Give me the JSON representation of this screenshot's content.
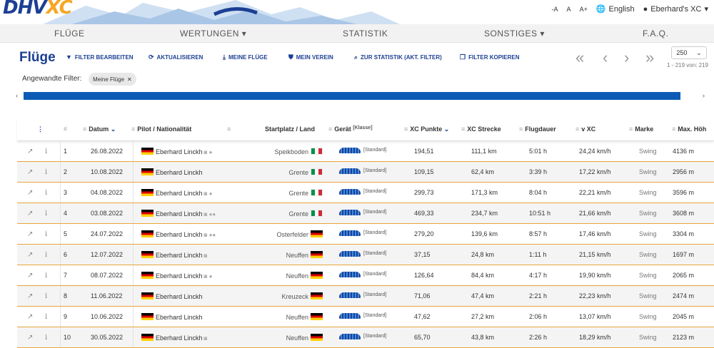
{
  "header": {
    "logo_main": "DHV",
    "logo_xc": "XC",
    "font_small": "-A",
    "font_normal": "A",
    "font_large": "A+",
    "language": "English",
    "user": "Eberhard's XC"
  },
  "nav": {
    "items": [
      "FLÜGE",
      "WERTUNGEN ▾",
      "STATISTIK",
      "SONSTIGES ▾",
      "F.A.Q."
    ]
  },
  "toolbar": {
    "title": "Flüge",
    "buttons": [
      "FILTER BEARBEITEN",
      "AKTUALISIEREN",
      "MEINE FLÜGE",
      "MEIN VEREIN",
      "ZUR STATISTIK (AKT. FILTER)",
      "FILTER KOPIEREN"
    ],
    "pager": [
      "«",
      "‹",
      "›",
      "»"
    ],
    "per_page": "250",
    "range": "1 - 219 von: 219"
  },
  "filter": {
    "label": "Angewandte Filter:",
    "chip": "Meine Flüge"
  },
  "table": {
    "headers": {
      "num": "#",
      "date": "Datum",
      "pilot": "Pilot / Nationalität",
      "start": "Startplatz / Land",
      "device": "Gerät",
      "device_class": "[Klasse]",
      "points": "XC Punkte",
      "distance": "XC Strecke",
      "duration": "Flugdauer",
      "speed": "v XC",
      "brand": "Marke",
      "height": "Max. Höh"
    },
    "rows": [
      {
        "n": "1",
        "date": "26.08.2022",
        "pilot": "Eberhard Linckh",
        "icons": "◙ ●",
        "start": "Speikboden",
        "country": "it",
        "cls": "[Standard]",
        "points": "194,51",
        "dist": "111,1 km",
        "dur": "5:01 h",
        "speed": "24,24 km/h",
        "brand": "Swing",
        "height": "4136 m"
      },
      {
        "n": "2",
        "date": "10.08.2022",
        "pilot": "Eberhard Linckh",
        "icons": "",
        "start": "Grente",
        "country": "it",
        "cls": "[Standard]",
        "points": "109,15",
        "dist": "62,4 km",
        "dur": "3:39 h",
        "speed": "17,22 km/h",
        "brand": "Swing",
        "height": "2956 m"
      },
      {
        "n": "3",
        "date": "04.08.2022",
        "pilot": "Eberhard Linckh",
        "icons": "◙ ●",
        "start": "Grente",
        "country": "it",
        "cls": "[Standard]",
        "points": "299,73",
        "dist": "171,3 km",
        "dur": "8:04 h",
        "speed": "22,21 km/h",
        "brand": "Swing",
        "height": "3596 m"
      },
      {
        "n": "4",
        "date": "03.08.2022",
        "pilot": "Eberhard Linckh",
        "icons": "◙ ●●",
        "start": "Grente",
        "country": "it",
        "cls": "[Standard]",
        "points": "469,33",
        "dist": "234,7 km",
        "dur": "10:51 h",
        "speed": "21,66 km/h",
        "brand": "Swing",
        "height": "3608 m"
      },
      {
        "n": "5",
        "date": "24.07.2022",
        "pilot": "Eberhard Linckh",
        "icons": "◙ ●●",
        "start": "Osterfelder",
        "country": "de",
        "cls": "[Standard]",
        "points": "279,20",
        "dist": "139,6 km",
        "dur": "8:57 h",
        "speed": "17,46 km/h",
        "brand": "Swing",
        "height": "3304 m"
      },
      {
        "n": "6",
        "date": "12.07.2022",
        "pilot": "Eberhard Linckh",
        "icons": "◙",
        "start": "Neuffen",
        "country": "de",
        "cls": "[Standard]",
        "points": "37,15",
        "dist": "24,8 km",
        "dur": "1:11 h",
        "speed": "21,15 km/h",
        "brand": "Swing",
        "height": "1697 m"
      },
      {
        "n": "7",
        "date": "08.07.2022",
        "pilot": "Eberhard Linckh",
        "icons": "◙ ●",
        "start": "Neuffen",
        "country": "de",
        "cls": "[Standard]",
        "points": "126,64",
        "dist": "84,4 km",
        "dur": "4:17 h",
        "speed": "19,90 km/h",
        "brand": "Swing",
        "height": "2065 m"
      },
      {
        "n": "8",
        "date": "11.06.2022",
        "pilot": "Eberhard Linckh",
        "icons": "",
        "start": "Kreuzeck",
        "country": "de",
        "cls": "[Standard]",
        "points": "71,06",
        "dist": "47,4 km",
        "dur": "2:21 h",
        "speed": "22,23 km/h",
        "brand": "Swing",
        "height": "2474 m"
      },
      {
        "n": "9",
        "date": "10.06.2022",
        "pilot": "Eberhard Linckh",
        "icons": "",
        "start": "Neuffen",
        "country": "de",
        "cls": "[Standard]",
        "points": "47,62",
        "dist": "27,2 km",
        "dur": "2:06 h",
        "speed": "13,07 km/h",
        "brand": "Swing",
        "height": "2045 m"
      },
      {
        "n": "10",
        "date": "30.05.2022",
        "pilot": "Eberhard Linckh",
        "icons": "◙",
        "start": "Neuffen",
        "country": "de",
        "cls": "[Standard]",
        "points": "65,70",
        "dist": "43,8 km",
        "dur": "2:26 h",
        "speed": "18,29 km/h",
        "brand": "Swing",
        "height": "2123 m"
      }
    ]
  },
  "colors": {
    "brand_blue": "#1c3f94",
    "accent_orange": "#f5a623",
    "row_border": "#e8a53a",
    "scrollbar": "#0b5bb6"
  }
}
